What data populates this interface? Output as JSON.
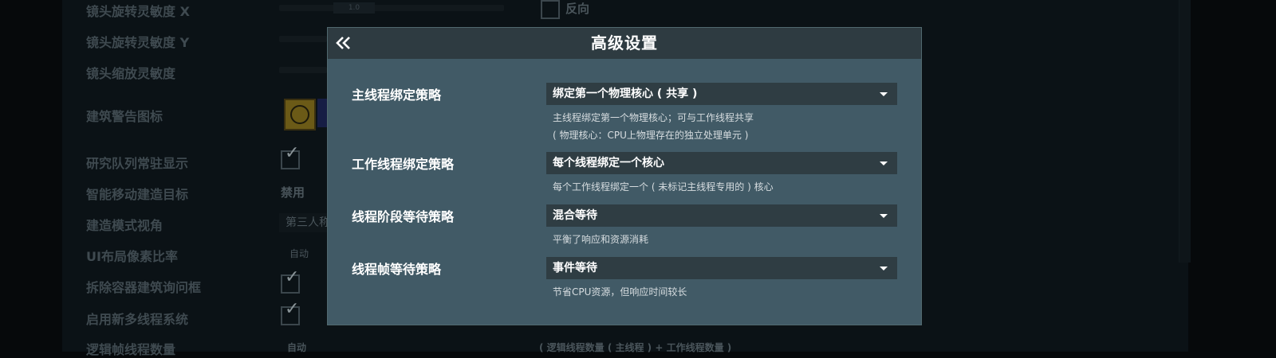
{
  "background": {
    "settings": [
      {
        "label": "镜头旋转灵敏度 X"
      },
      {
        "label": "镜头旋转灵敏度 Y"
      },
      {
        "label": "镜头缩放灵敏度"
      },
      {
        "label": "建筑警告图标"
      },
      {
        "label": "研究队列常驻显示"
      },
      {
        "label": "智能移动建造目标"
      },
      {
        "label": "建造模式视角"
      },
      {
        "label": "UI布局像素比率"
      },
      {
        "label": "拆除容器建筑询问框"
      },
      {
        "label": "启用新多线程系统"
      },
      {
        "label": "逻辑帧线程数量"
      }
    ],
    "slider_x_value": "1.0",
    "reverse_label": "反向",
    "smart_move_value": "禁用",
    "view_mode_value": "第三人称",
    "ui_ratio_value": "自动",
    "thread_count_value": "自动",
    "thread_count_desc": "( 逻辑线程数量 ( 主线程 ) + 工作线程数量 )",
    "icon_colors": {
      "warning_button": "#6b5a17",
      "alt_button": "#161d44"
    }
  },
  "modal": {
    "title": "高级设置",
    "back_icon": "double-chevron-left-icon",
    "rows": [
      {
        "label": "主线程绑定策略",
        "value": "绑定第一个物理核心 ( 共享 )",
        "desc": [
          "主线程绑定第一个物理核心；可与工作线程共享",
          "( 物理核心：CPU上物理存在的独立处理单元 )"
        ]
      },
      {
        "label": "工作线程绑定策略",
        "value": "每个线程绑定一个核心",
        "desc": [
          "每个工作线程绑定一个 ( 未标记主线程专用的 ) 核心"
        ]
      },
      {
        "label": "线程阶段等待策略",
        "value": "混合等待",
        "desc": [
          "平衡了响应和资源消耗"
        ]
      },
      {
        "label": "线程帧等待策略",
        "value": "事件等待",
        "desc": [
          "节省CPU资源，但响应时间较长"
        ]
      }
    ],
    "colors": {
      "panel": "#415a66",
      "header": "#2e3b41",
      "dropdown": "#2f3d43"
    }
  }
}
